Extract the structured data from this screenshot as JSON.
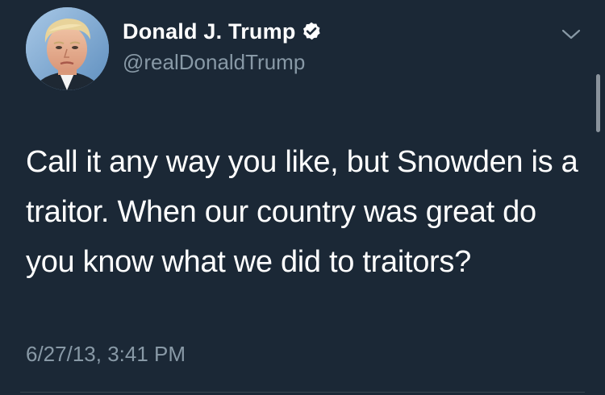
{
  "tweet": {
    "author": {
      "display_name": "Donald J. Trump",
      "handle": "@realDonaldTrump",
      "verified": true
    },
    "text": "Call it any way you like, but Snowden is a traitor. When our country was great do you know what we did to traitors?",
    "timestamp": "6/27/13, 3:41 PM"
  },
  "icons": {
    "verified": "verified-badge-icon",
    "menu": "chevron-down-icon"
  },
  "colors": {
    "background": "#1b2836",
    "primary_text": "#ffffff",
    "secondary_text": "#8899a6",
    "divider": "#38444d"
  }
}
